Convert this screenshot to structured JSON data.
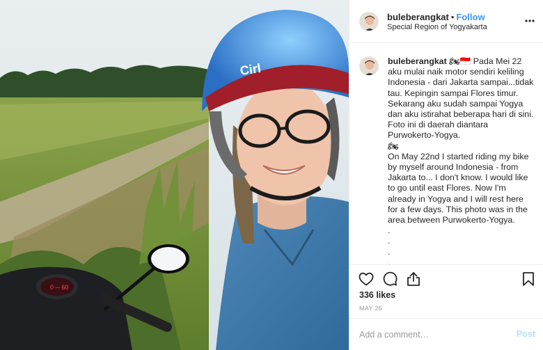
{
  "post": {
    "username": "buleberangkat",
    "separator": "•",
    "follow_label": "Follow",
    "location": "Special Region of Yogyakarta"
  },
  "caption": {
    "username": "buleberangkat",
    "text": " 🏍🇮🇩 Pada Mei 22 aku mulai naik motor sendiri keliling Indonesia - dari Jakarta sampai...tidak tau. Kepingin sampai Flores timur. Sekarang aku sudah sampai Yogya dan aku istirahat beberapa hari di sini. Foto ini di daerah diantara Purwokerto-Yogya.\n🏍\nOn May 22nd I started riding my bike by myself around Indonesia - from Jakarta to... I don't know. I would like to go until east Flores. Now I'm already in Yogya and I will rest here for a few days. This photo was in the area between Purwokerto-Yogya.\n.\n.\n.\n."
  },
  "stats": {
    "likes": "336 likes",
    "date": "MAY 26"
  },
  "comment": {
    "placeholder": "Add a comment…",
    "post_label": "Post"
  },
  "icons": {
    "more": "more-options-icon",
    "like": "heart-icon",
    "comment": "comment-bubble-icon",
    "share": "share-icon",
    "save": "bookmark-icon"
  },
  "colors": {
    "follow": "#3897f0",
    "post_disabled": "#b2dffc",
    "muted": "#999999",
    "text": "#262626"
  }
}
